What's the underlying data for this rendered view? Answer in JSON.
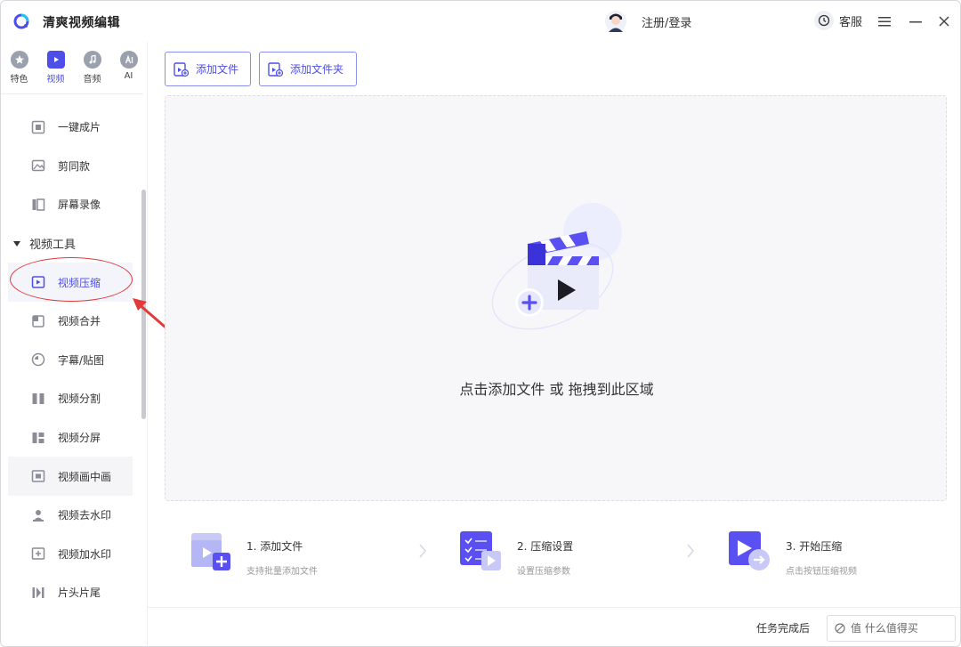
{
  "window": {
    "title": "清爽视频编辑",
    "login_label": "注册/登录",
    "service_label": "客服"
  },
  "categories": [
    {
      "label": "特色",
      "icon": "star-icon",
      "active": false
    },
    {
      "label": "视频",
      "icon": "video-icon",
      "active": true
    },
    {
      "label": "音频",
      "icon": "audio-icon",
      "active": false
    },
    {
      "label": "AI",
      "icon": "ai-icon",
      "active": false
    }
  ],
  "sidebar": {
    "items_top": [
      {
        "label": "一键成片",
        "icon": "one-click-icon"
      },
      {
        "label": "剪同款",
        "icon": "template-icon"
      },
      {
        "label": "屏幕录像",
        "icon": "screen-record-icon"
      }
    ],
    "group_label": "视频工具",
    "group_items": [
      {
        "label": "视频压缩",
        "icon": "compress-icon",
        "selected": true
      },
      {
        "label": "视频合并",
        "icon": "merge-icon"
      },
      {
        "label": "字幕/贴图",
        "icon": "subtitle-icon"
      },
      {
        "label": "视频分割",
        "icon": "split-icon"
      },
      {
        "label": "视频分屏",
        "icon": "split-screen-icon"
      },
      {
        "label": "视频画中画",
        "icon": "pip-icon"
      },
      {
        "label": "视频去水印",
        "icon": "remove-watermark-icon"
      },
      {
        "label": "视频加水印",
        "icon": "add-watermark-icon"
      },
      {
        "label": "片头片尾",
        "icon": "intro-outro-icon"
      }
    ]
  },
  "toolbar": {
    "add_file": "添加文件",
    "add_folder": "添加文件夹"
  },
  "dropzone": {
    "text": "点击添加文件 或 拖拽到此区域"
  },
  "steps": [
    {
      "title": "1. 添加文件",
      "subtitle": "支持批量添加文件",
      "icon": "add-file-step-icon"
    },
    {
      "title": "2. 压缩设置",
      "subtitle": "设置压缩参数",
      "icon": "settings-step-icon"
    },
    {
      "title": "3. 开始压缩",
      "subtitle": "点击按钮压缩视频",
      "icon": "start-step-icon"
    }
  ],
  "statusbar": {
    "after_task_label": "任务完成后",
    "watermark": "值 什么值得买"
  },
  "colors": {
    "accent": "#4e4ee8",
    "annotation": "#e23a3a"
  }
}
